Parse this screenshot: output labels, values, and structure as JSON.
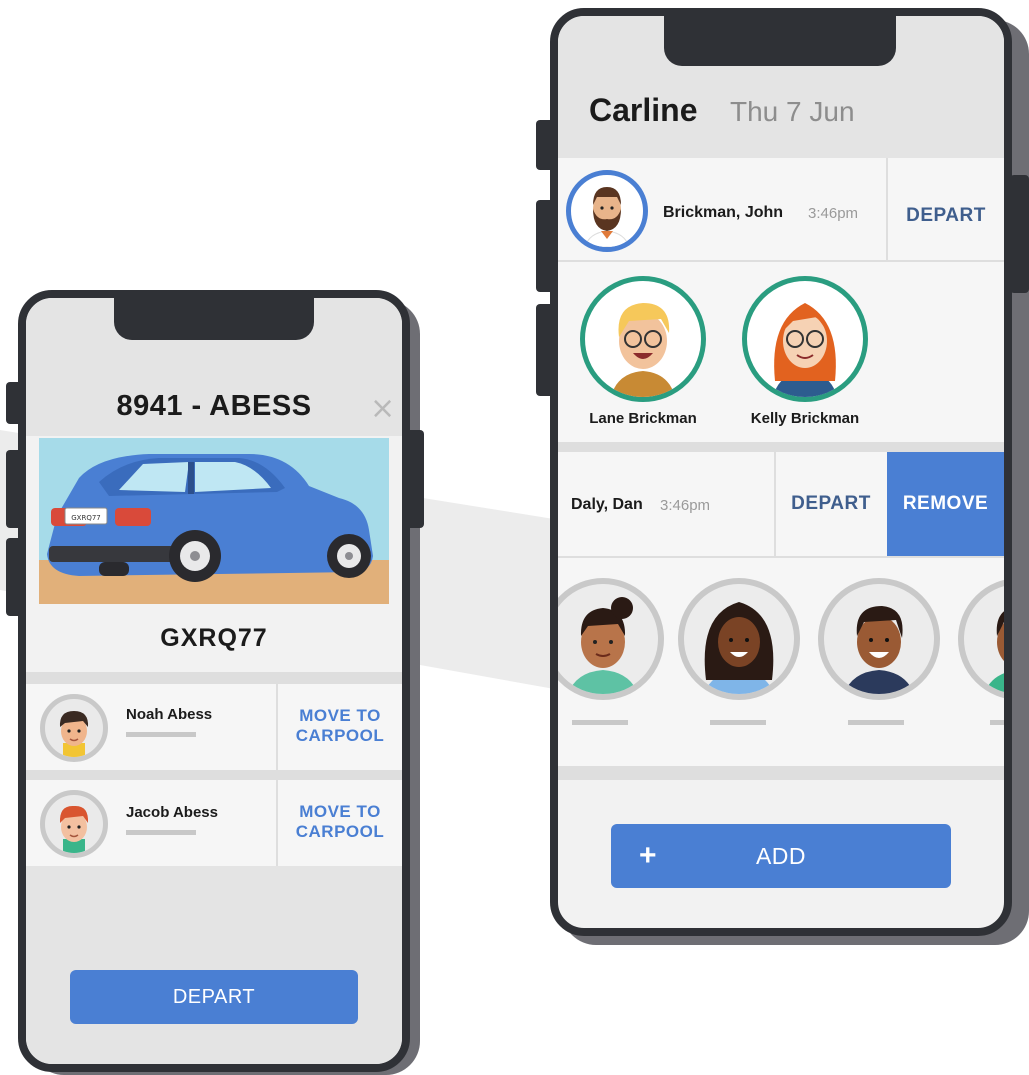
{
  "left_phone": {
    "title": "8941 - ABESS",
    "close_glyph": "×",
    "plate": "GXRQ77",
    "car_plate_small": "GXRQ77",
    "students": [
      {
        "name": "Noah Abess",
        "action": "MOVE TO\nCARPOOL"
      },
      {
        "name": "Jacob Abess",
        "action": "MOVE TO\nCARPOOL"
      }
    ],
    "depart_label": "DEPART"
  },
  "right_phone": {
    "title": "Carline",
    "date": "Thu 7 Jun",
    "rows": [
      {
        "name": "Brickman, John",
        "time": "3:46pm",
        "action": "DEPART"
      },
      {
        "name": "Daly, Dan",
        "time": "3:46pm",
        "action": "DEPART",
        "action2": "REMOVE"
      }
    ],
    "children": [
      {
        "name": "Lane Brickman"
      },
      {
        "name": "Kelly Brickman"
      }
    ],
    "add_label": "ADD",
    "add_icon": "+"
  },
  "colors": {
    "accent": "#4a7fd3",
    "frame": "#2f3136",
    "screen": "#f2f2f2",
    "header": "#e4e4e4",
    "teal_ring": "#2a9d80",
    "blue_ring": "#4a7fd3"
  }
}
